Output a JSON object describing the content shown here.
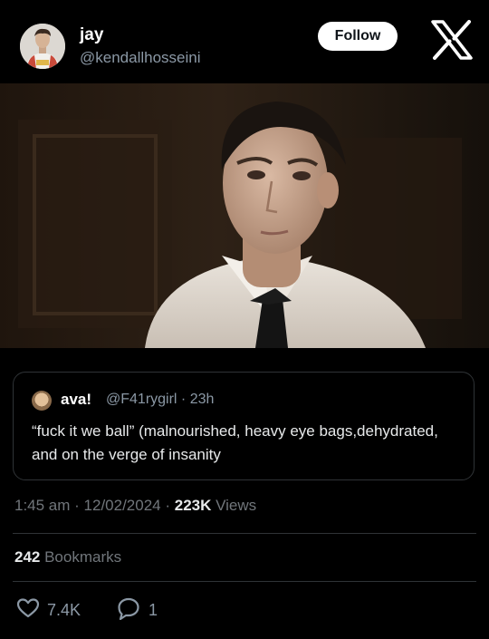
{
  "header": {
    "display_name": "jay",
    "handle": "@kendallhosseini",
    "follow_label": "Follow"
  },
  "quote": {
    "name": "ava!",
    "meta": "@F41rygirl · 23h",
    "text": "“fuck it we ball” (malnourished, heavy eye bags,dehydrated, and on the verge of insanity"
  },
  "stats": {
    "time": "1:45 am",
    "sep1": " · ",
    "date": "12/02/2024",
    "sep2": " · ",
    "views_count": "223K",
    "views_label": " Views",
    "bookmarks_count": "242",
    "bookmarks_label": " Bookmarks"
  },
  "actions": {
    "likes": "7.4K",
    "replies": "1"
  },
  "colors": {
    "background": "#000000",
    "text_primary": "#e7e9ea",
    "text_secondary": "#71767b",
    "border": "#2f3336"
  }
}
